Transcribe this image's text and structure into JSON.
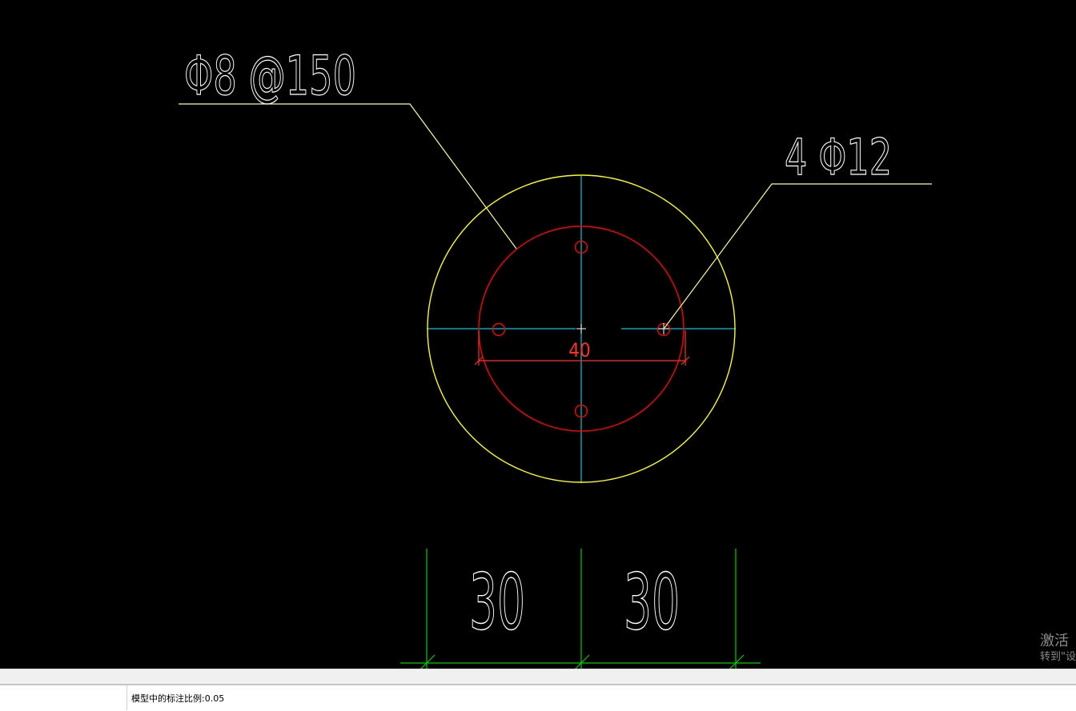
{
  "drawing": {
    "stirrup_label": "Φ8 @150",
    "rebar_label": "4 Φ12",
    "diameter_dim": "40",
    "bottom_dims": [
      "30",
      "30"
    ],
    "colors": {
      "outer_circle": "#ffff00",
      "inner_circle": "#ff0000",
      "rebar": "#ff0000",
      "center_lines": "#00c8e0",
      "leaders": "#ffff80",
      "dim_lines_bottom": "#00d000",
      "dim_diameter": "#ff3020",
      "text": "#ffffff"
    }
  },
  "watermark": {
    "title": "激活",
    "subtitle": "转到\"设"
  },
  "status": {
    "text": "模型中的标注比例:0.05"
  }
}
